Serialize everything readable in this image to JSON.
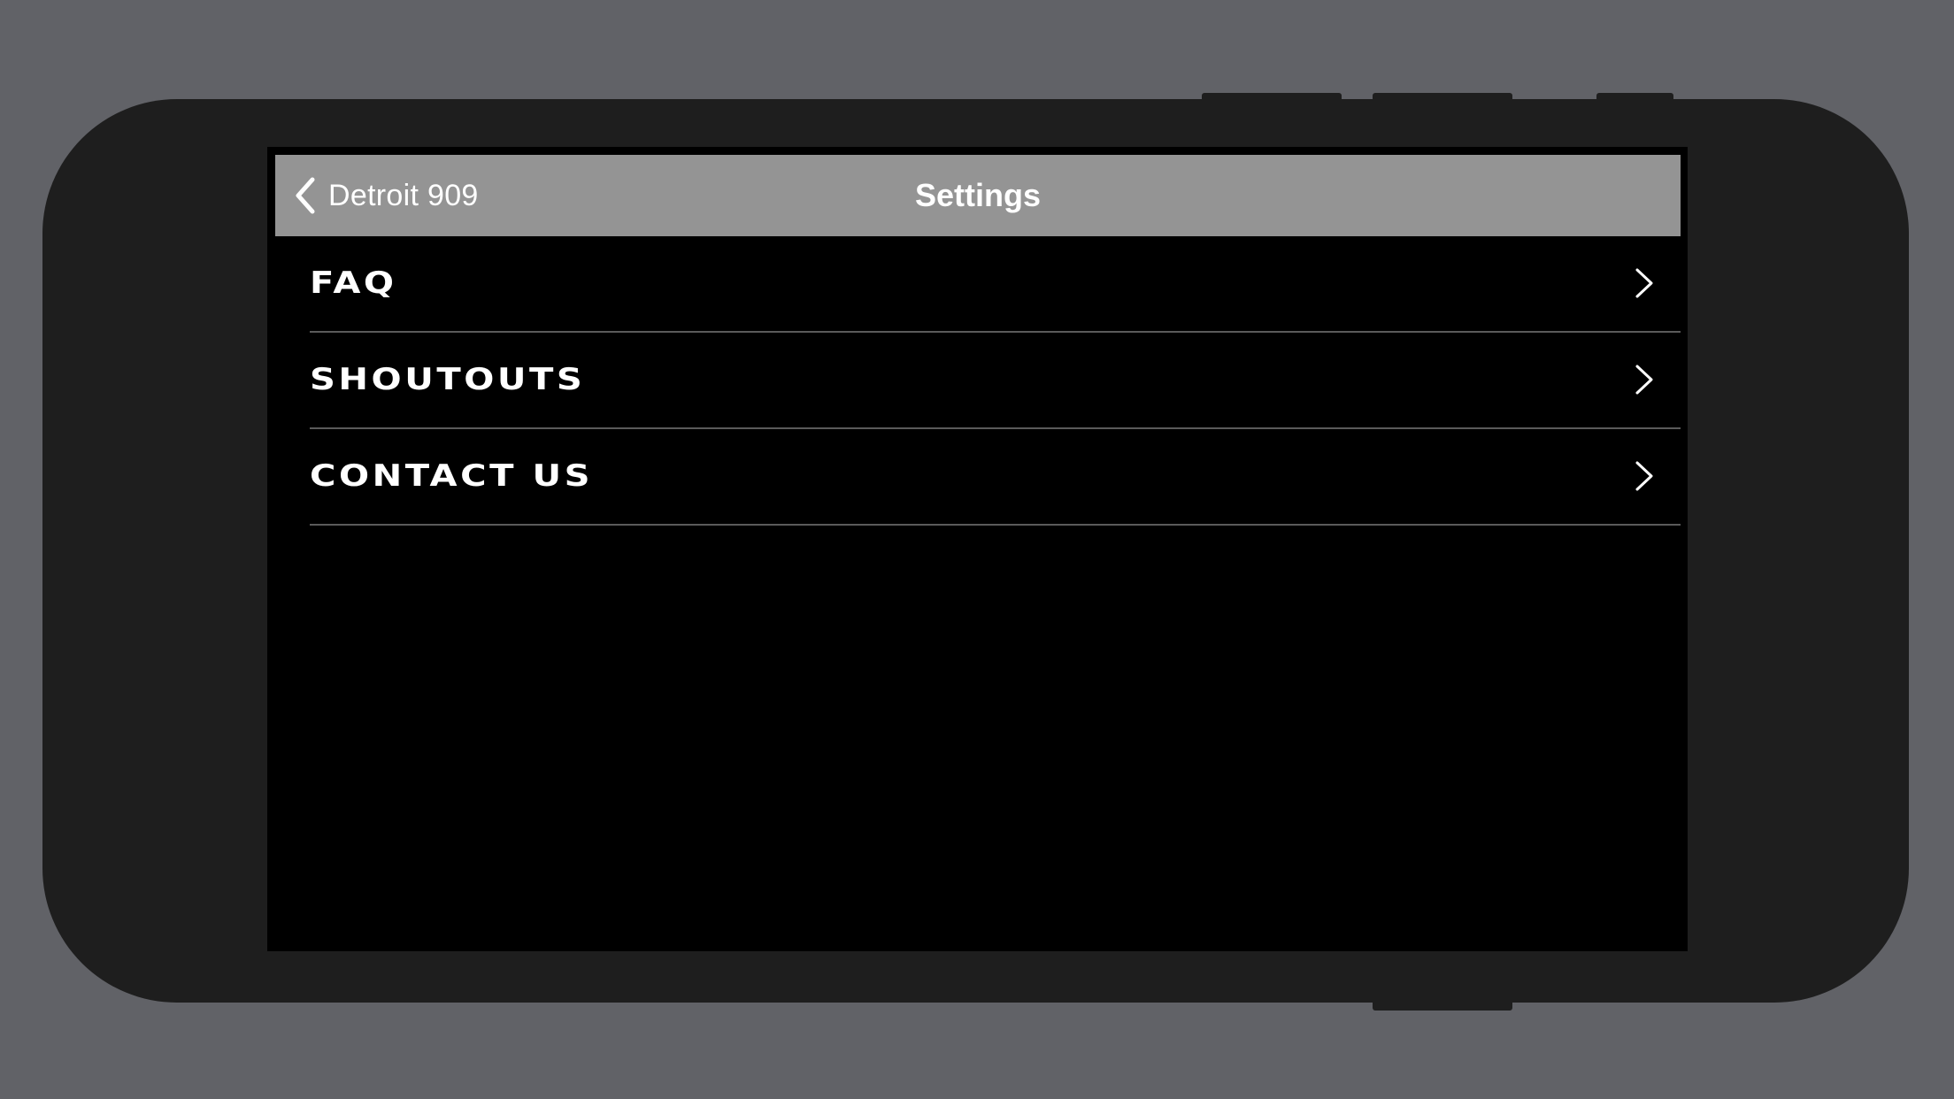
{
  "navbar": {
    "back_label": "Detroit 909",
    "title": "Settings"
  },
  "settings": {
    "items": [
      {
        "label": "FAQ",
        "icon": "chevron-right-icon"
      },
      {
        "label": "SHOUTOUTS",
        "icon": "chevron-right-icon"
      },
      {
        "label": "CONTACT US",
        "icon": "chevron-right-icon"
      }
    ]
  },
  "colors": {
    "background": "#616267",
    "device": "#1e1e1e",
    "navbar": "#949494",
    "screen": "#000000",
    "text": "#ffffff",
    "separator": "#5a5a5a"
  },
  "icons": {
    "back": "chevron-left-icon"
  }
}
